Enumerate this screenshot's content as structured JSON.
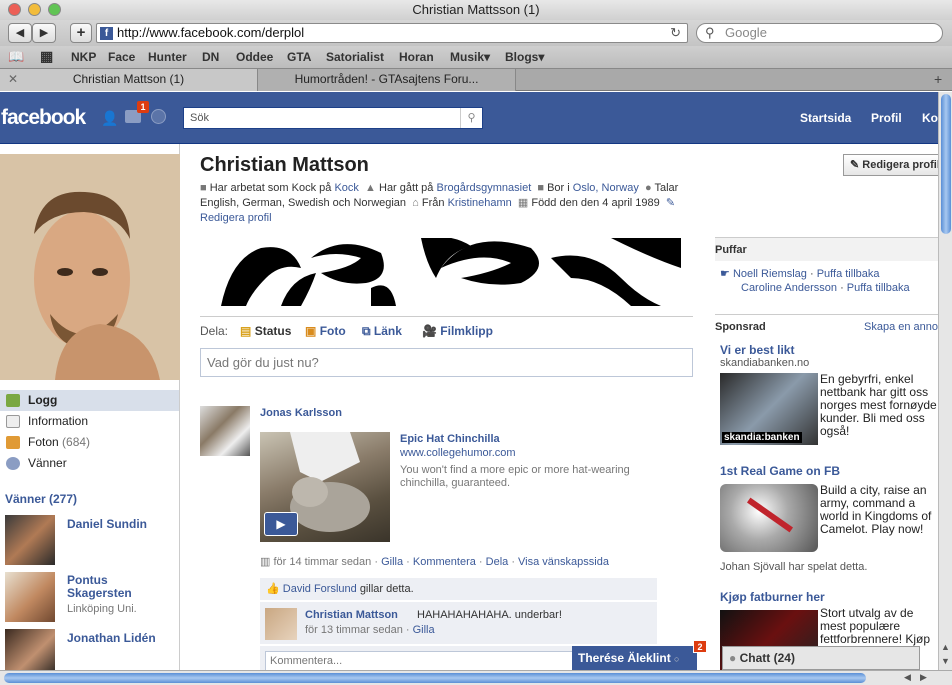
{
  "browser": {
    "window_title": "Christian Mattsson (1)",
    "url": "http://www.facebook.com/derplol",
    "search_placeholder": "Google",
    "bookmarks": [
      "NKP",
      "Face",
      "Hunter",
      "DN",
      "Oddee",
      "GTA",
      "Satorialist",
      "Horan",
      "Musik▾",
      "Blogs▾"
    ],
    "tabs": [
      "Christian Mattson (1)",
      "Humortråden! - GTAsajtens Foru..."
    ]
  },
  "fb": {
    "logo": "facebook",
    "notification_count": "1",
    "search_placeholder": "Sök",
    "nav": [
      "Startsida",
      "Profil",
      "Konto"
    ]
  },
  "profile": {
    "name": "Christian Mattson",
    "edit_button": "Redigera profil",
    "info": {
      "work_prefix": "Har arbetat som Kock på",
      "work_link": "Kock",
      "school_prefix": "Har gått på",
      "school_link": "Brogårdsgymnasiet",
      "lives_prefix": "Bor i",
      "lives_link_1": "Oslo,",
      "lives_link_2": "Norway",
      "languages": "Talar English, German, Swedish och Norwegian",
      "from_prefix": "Från",
      "from_link": "Kristinehamn",
      "born": "Född den den 4 april 1989",
      "edit_profile": "Redigera profil"
    }
  },
  "left_menu": [
    {
      "label": "Logg",
      "icon": "wall-icon"
    },
    {
      "label": "Information",
      "icon": "info-icon"
    },
    {
      "label": "Foton",
      "count": "(684)",
      "icon": "photos-icon"
    },
    {
      "label": "Vänner",
      "icon": "friends-icon"
    }
  ],
  "friends": {
    "header": "Vänner (277)",
    "items": [
      {
        "name": "Daniel Sundin",
        "sub": ""
      },
      {
        "name": "Pontus Skagersten",
        "sub": "Linköping Uni."
      },
      {
        "name": "Jonathan Lidén",
        "sub": ""
      }
    ]
  },
  "composer": {
    "share_label": "Dela:",
    "options": [
      "Status",
      "Foto",
      "Länk",
      "Filmklipp"
    ],
    "placeholder": "Vad gör du just nu?"
  },
  "post": {
    "author": "Jonas Karlsson",
    "link_title": "Epic Hat Chinchilla",
    "link_url": "www.collegehumor.com",
    "link_desc": "You won't find a more epic or more hat-wearing chinchilla, guaranteed.",
    "meta_time": "för 14 timmar sedan",
    "actions": [
      "Gilla",
      "Kommentera",
      "Dela",
      "Visa vänskapssida"
    ],
    "like_name": "David Forslund",
    "like_suffix": "gillar detta.",
    "comment_author": "Christian Mattson",
    "comment_text": "HAHAHAHAHAHA. underbar!",
    "comment_time": "för 13 timmar sedan",
    "comment_like": "Gilla",
    "comment_placeholder": "Kommentera..."
  },
  "pokes": {
    "header": "Puffar",
    "items": [
      {
        "name": "Noell Riemslag",
        "action": "Puffa tillbaka"
      },
      {
        "name": "Caroline Andersson",
        "action": "Puffa tillbaka"
      }
    ]
  },
  "ads": {
    "header": "Sponsrad",
    "create": "Skapa en annons",
    "items": [
      {
        "title": "Vi er best likt",
        "sub": "skandiabanken.no",
        "text": "En gebyrfri, enkel nettbank har gitt oss norges mest fornøyde kunder. Bli med oss også!",
        "image_caption": "skandia:banken"
      },
      {
        "title": "1st Real Game on FB",
        "sub": "",
        "text": "Build a city, raise an army, command a world in Kingdoms of Camelot. Play now!",
        "footer": "Johan Sjövall har spelat detta."
      },
      {
        "title": "Kjøp fatburner her",
        "sub": "",
        "text": "Stort utvalg av de mest populære fettforbrennere! Kjøp her"
      }
    ]
  },
  "chat": {
    "tab_name": "Therése Äleklint",
    "tab_badge": "2",
    "chat_label": "Chatt",
    "chat_count": "(24)"
  },
  "colors": {
    "fb_blue": "#3b5998",
    "fb_dark": "#133783",
    "badge_red": "#dd3c10"
  }
}
